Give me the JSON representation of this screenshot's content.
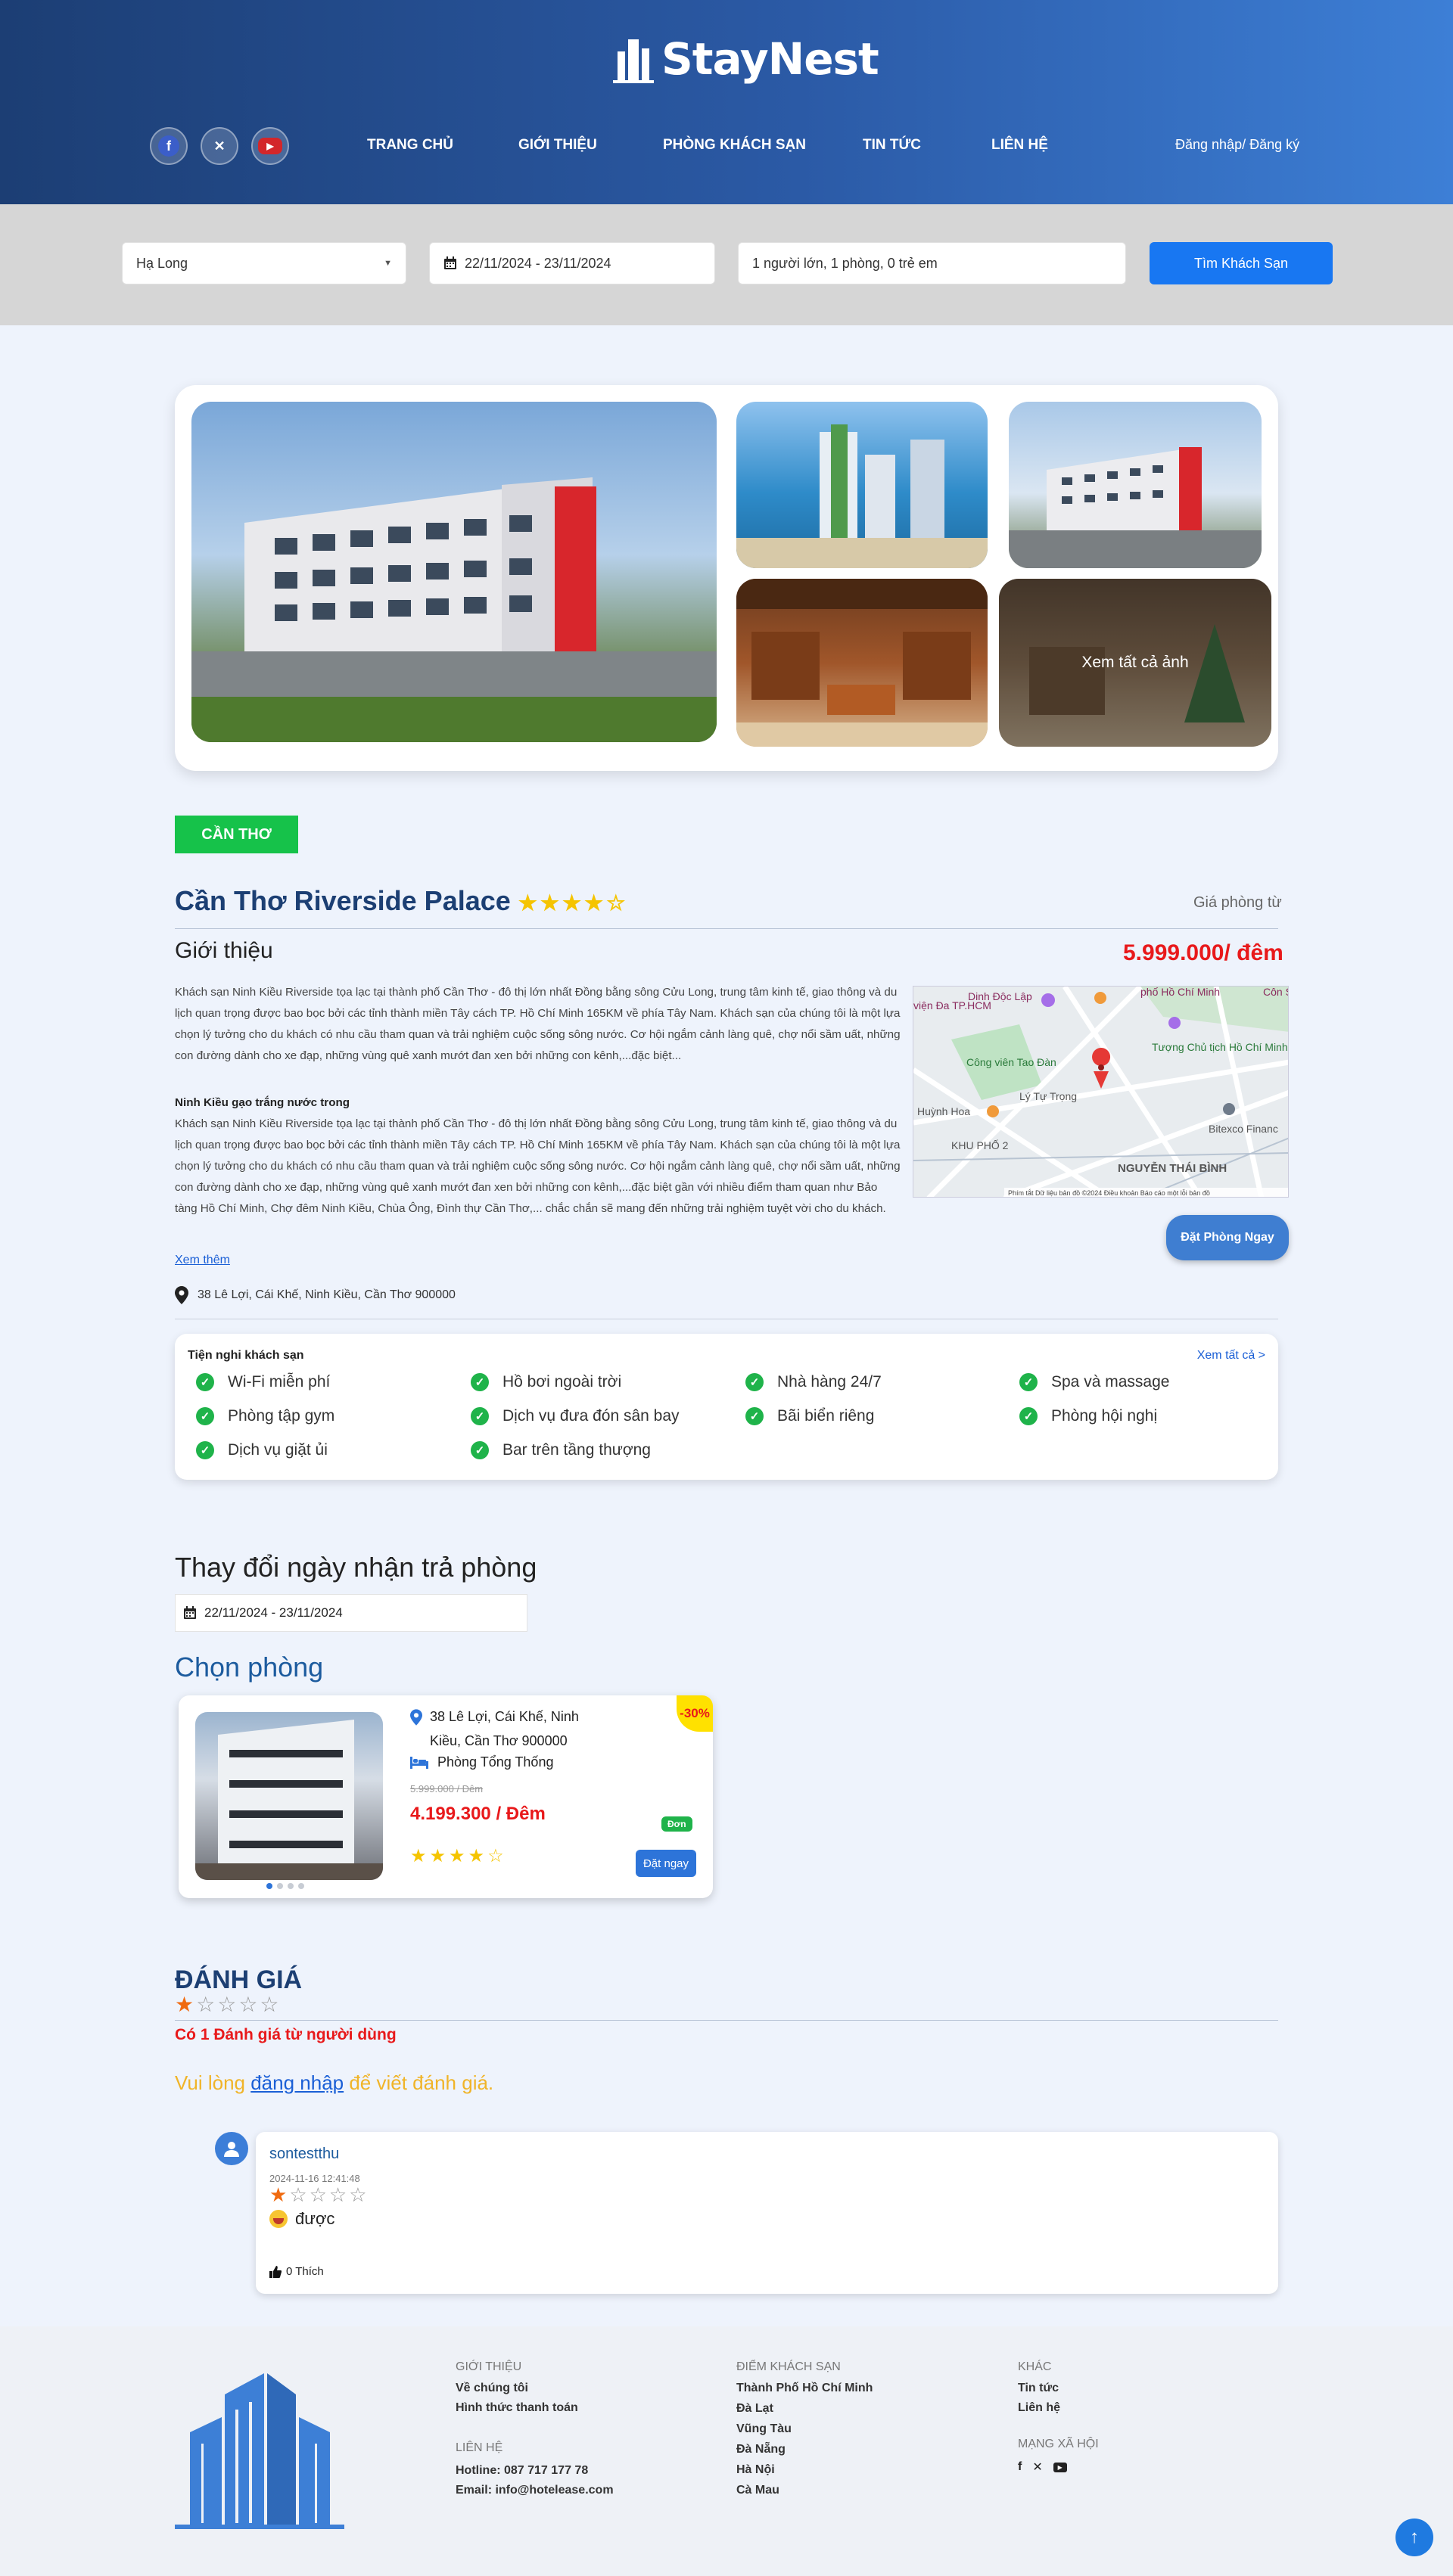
{
  "brand": {
    "name": "StayNest"
  },
  "nav": {
    "items": [
      "TRANG CHỦ",
      "GIỚI THIỆU",
      "PHÒNG KHÁCH SẠN",
      "TIN TỨC",
      "LIÊN HỆ"
    ],
    "auth": "Đăng nhập/  Đăng ký"
  },
  "search": {
    "location": "Hạ Long",
    "dates": "22/11/2024 - 23/11/2024",
    "guests": "1 người lớn, 1 phòng, 0 trẻ em",
    "button": "Tìm Khách Sạn"
  },
  "gallery": {
    "see_all": "Xem tất cả ảnh"
  },
  "hotel": {
    "city_badge": "CẦN THƠ",
    "name": "Cần Thơ Riverside Palace",
    "stars": 4,
    "price_label": "Giá phòng từ",
    "price": "5.999.000/ đêm",
    "intro_heading": "Giới thiệu",
    "intro_text": "Khách sạn Ninh Kiều Riverside tọa lạc tại thành phố Cần Thơ - đô thị lớn nhất Đồng bằng sông Cửu Long, trung tâm kinh tế, giao thông và du lịch quan trọng được bao bọc bởi các tỉnh thành miền Tây cách TP. Hồ Chí Minh 165KM về phía Tây Nam. Khách sạn của chúng tôi là một lựa chọn lý tưởng cho du khách có nhu cầu tham quan và trải nghiệm cuộc sống sông nước. Cơ hội ngắm cảnh làng quê, chợ nổi sầm uất, những con đường dành cho xe đạp, những vùng quê xanh mướt đan xen bởi những con kênh,...đặc biệt...",
    "sub_heading": "Ninh Kiều gạo trắng nước trong",
    "sub_text": "Khách sạn Ninh Kiều Riverside tọa lạc tại thành phố Cần Thơ - đô thị lớn nhất Đồng bằng sông Cửu Long, trung tâm kinh tế, giao thông và du lịch quan trọng được bao bọc bởi các tỉnh thành miền Tây cách TP. Hồ Chí Minh 165KM về phía Tây Nam. Khách sạn của chúng tôi là một lựa chọn lý tưởng cho du khách có nhu cầu tham quan và trải nghiệm cuộc sống sông nước. Cơ hội ngắm cảnh làng quê, chợ nổi sầm uất, những con đường dành cho xe đạp, những vùng quê xanh mướt đan xen bởi những con kênh,...đặc biệt gần với nhiều điểm tham quan như Bảo tàng Hồ Chí Minh, Chợ đêm Ninh Kiều, Chùa Ông, Đình thự Cần Thơ,... chắc chắn sẽ mang đến những trải nghiệm tuyệt vời cho du khách.",
    "read_more": "Xem thêm",
    "address": "38 Lê Lợi, Cái Khế, Ninh Kiều, Cần Thơ 900000",
    "book_button": "Đặt Phòng Ngay"
  },
  "map": {
    "labels": [
      "Dinh Độc Lập",
      "phố Hồ Chí Minh",
      "Côn Sài Gò",
      "viện Đa TP.HCM",
      "Công viên Tao Đàn",
      "Tượng Chủ tịch Hồ Chí Minh",
      "Huỳnh Hoa",
      "Lý Tự Trọng",
      "KHU PHỐ 2",
      "Bitexco Financ",
      "NGUYỄN THÁI BÌNH"
    ],
    "footer": "Phím tắt   Dữ liệu bản đồ ©2024   Điều khoản   Báo cáo một lỗi bản đồ"
  },
  "amenities": {
    "title": "Tiện nghi khách sạn",
    "see_all": "Xem tất cả >",
    "items": [
      "Wi-Fi miễn phí",
      "Hồ bơi ngoài trời",
      "Nhà hàng 24/7",
      "Spa và massage",
      "Phòng tập gym",
      "Dịch vụ đưa đón sân bay",
      "Bãi biển riêng",
      "Phòng hội nghị",
      "Dịch vụ giặt ủi",
      "Bar trên tầng thượng"
    ]
  },
  "change_dates": {
    "heading": "Thay đổi ngày nhận trả phòng",
    "value": "22/11/2024 - 23/11/2024"
  },
  "rooms": {
    "heading": "Chọn phòng",
    "card": {
      "address": "38 Lê Lợi, Cái Khế, Ninh Kiều, Cần Thơ 900000",
      "room_type": "Phòng Tổng Thống",
      "old_price": "5.999.000 / Đêm",
      "price": "4.199.300 / Đêm",
      "discount": "-30%",
      "tag": "Đơn",
      "stars": 4,
      "button": "Đặt ngay"
    }
  },
  "reviews": {
    "heading": "ĐÁNH GIÁ",
    "rating": 1,
    "count": "Có 1 Đánh giá từ người dùng",
    "login_prefix": "Vui lòng ",
    "login_link": "đăng nhập",
    "login_suffix": " để viết đánh giá.",
    "items": [
      {
        "user": "sontestthu",
        "date": "2024-11-16 12:41:48",
        "rating": 1,
        "text": "được",
        "likes": "0 Thích"
      }
    ]
  },
  "footer": {
    "about": {
      "heading": "GIỚI THIỆU",
      "links": [
        "Về chúng tôi",
        "Hình thức thanh toán"
      ]
    },
    "contact": {
      "heading": "LIÊN HỆ",
      "hotline": "Hotline: 087 717 177 78",
      "email": "Email: info@hotelease.com"
    },
    "destinations": {
      "heading": "ĐIỂM KHÁCH SẠN",
      "links": [
        "Thành Phố Hồ Chí Minh",
        "Đà Lạt",
        "Vũng Tàu",
        "Đà Nẵng",
        "Hà Nội",
        "Cà Mau"
      ]
    },
    "other": {
      "heading": "KHÁC",
      "links": [
        "Tin tức",
        "Liên hệ"
      ]
    },
    "social": {
      "heading": "MẠNG XÃ HỘI"
    }
  },
  "colors": {
    "header_start": "#1c3e74",
    "header_end": "#3d7fd6",
    "accent": "#1877f2",
    "price": "#e8191b",
    "success": "#16c24a",
    "star": "#f5c400"
  }
}
